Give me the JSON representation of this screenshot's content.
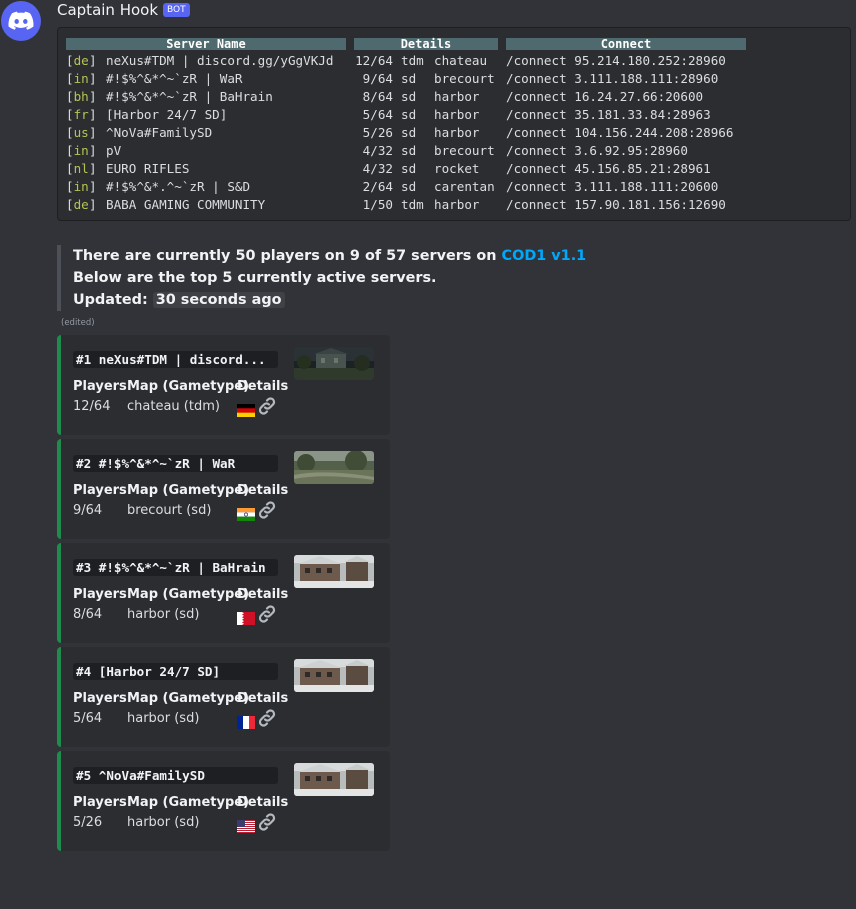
{
  "message": {
    "username": "Captain Hook",
    "badge": "BOT",
    "edited": "(edited)"
  },
  "table": {
    "headers": [
      "Server Name",
      "Details",
      "Connect"
    ],
    "rows": [
      {
        "cc": "de",
        "name": "neXus#TDM | discord.gg/yGgVKJd",
        "players": "12/64",
        "mode": "tdm",
        "map": "chateau",
        "connect": "/connect 95.214.180.252:28960"
      },
      {
        "cc": "in",
        "name": "#!$%^&*^~`zR | WaR",
        "players": "9/64",
        "mode": "sd",
        "map": "brecourt",
        "connect": "/connect 3.111.188.111:28960"
      },
      {
        "cc": "bh",
        "name": "#!$%^&*^~`zR | BaHrain",
        "players": "8/64",
        "mode": "sd",
        "map": "harbor",
        "connect": "/connect 16.24.27.66:20600"
      },
      {
        "cc": "fr",
        "name": "[Harbor 24/7 SD]",
        "players": "5/64",
        "mode": "sd",
        "map": "harbor",
        "connect": "/connect 35.181.33.84:28963"
      },
      {
        "cc": "us",
        "name": "^NoVa#FamilySD",
        "players": "5/26",
        "mode": "sd",
        "map": "harbor",
        "connect": "/connect 104.156.244.208:28966"
      },
      {
        "cc": "in",
        "name": "pV",
        "players": "4/32",
        "mode": "sd",
        "map": "brecourt",
        "connect": "/connect 3.6.92.95:28960"
      },
      {
        "cc": "nl",
        "name": "EURO RIFLES",
        "players": "4/32",
        "mode": "sd",
        "map": "rocket",
        "connect": "/connect 45.156.85.21:28961"
      },
      {
        "cc": "in",
        "name": "#!$%^&*.^~`zR | S&D",
        "players": "2/64",
        "mode": "sd",
        "map": "carentan",
        "connect": "/connect 3.111.188.111:20600"
      },
      {
        "cc": "de",
        "name": "BABA GAMING COMMUNITY",
        "players": "1/50",
        "mode": "tdm",
        "map": "harbor",
        "connect": "/connect 157.90.181.156:12690"
      }
    ]
  },
  "summary": {
    "line1_prefix": "There are currently 50 players on 9 of 57 servers on ",
    "line1_link": "COD1 v1.1",
    "line2": "Below are the top 5 currently active servers.",
    "line3_label": "Updated: ",
    "line3_value": "30 seconds ago"
  },
  "embeds": [
    {
      "title": "#1 neXus#TDM | discord...",
      "players": "12/64",
      "map": "chateau (tdm)",
      "flag": "de",
      "thumb": "chateau"
    },
    {
      "title": "#2 #!$%^&*^~`zR | WaR",
      "players": "9/64",
      "map": "brecourt (sd)",
      "flag": "in",
      "thumb": "brecourt"
    },
    {
      "title": "#3 #!$%^&*^~`zR | BaHrain",
      "players": "8/64",
      "map": "harbor (sd)",
      "flag": "bh",
      "thumb": "harbor"
    },
    {
      "title": "#4 [Harbor 24/7 SD]",
      "players": "5/64",
      "map": "harbor (sd)",
      "flag": "fr",
      "thumb": "harbor"
    },
    {
      "title": "#5 ^NoVa#FamilySD",
      "players": "5/26",
      "map": "harbor (sd)",
      "flag": "us",
      "thumb": "harbor"
    }
  ],
  "embed_fields": {
    "players": "Players",
    "map": "Map (Gametype)",
    "details": "Details"
  },
  "colors": {
    "accent": "#5865f2",
    "embed_border": "#1f8b4c",
    "link": "#00a8fc",
    "country_code": "#b6c455"
  }
}
